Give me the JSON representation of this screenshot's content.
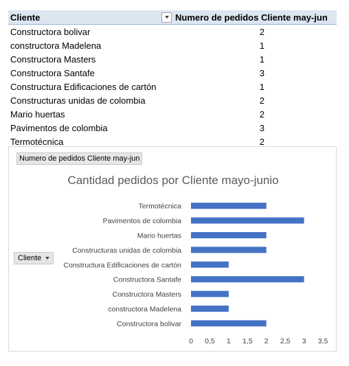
{
  "pivot": {
    "header_col1": "Cliente",
    "header_col2": "Numero de pedidos Cliente may-jun",
    "rows": [
      {
        "name": "Constructora bolivar",
        "value": "2"
      },
      {
        "name": "constructora Madelena",
        "value": "1"
      },
      {
        "name": "Constructora Masters",
        "value": "1"
      },
      {
        "name": "Constructora Santafe",
        "value": "3"
      },
      {
        "name": "Constructura Edificaciones de cartón",
        "value": "1"
      },
      {
        "name": "Constructuras unidas de colombia",
        "value": "2"
      },
      {
        "name": "Mario huertas",
        "value": "2"
      },
      {
        "name": "Pavimentos de colombia",
        "value": "3"
      },
      {
        "name": "Termotécnica",
        "value": "2"
      }
    ]
  },
  "chart_buttons": {
    "value_field": "Numero  de pedidos Cliente may-jun",
    "axis_field": "Cliente"
  },
  "chart_data": {
    "type": "bar",
    "orientation": "horizontal",
    "title": "Cantidad pedidos por Cliente mayo-junio",
    "categories": [
      "Constructora bolivar",
      "constructora Madelena",
      "Constructora Masters",
      "Constructora Santafe",
      "Constructura Edificaciones de cartón",
      "Constructuras unidas de colombia",
      "Mario huertas",
      "Pavimentos de colombia",
      "Termotécnica"
    ],
    "values": [
      2,
      1,
      1,
      3,
      1,
      2,
      2,
      3,
      2
    ],
    "xlim": [
      0,
      3.5
    ],
    "ticks": [
      0,
      0.5,
      1,
      1.5,
      2,
      2.5,
      3,
      3.5
    ],
    "tick_labels": [
      "0",
      "0,5",
      "1",
      "1,5",
      "2",
      "2,5",
      "3",
      "3,5"
    ],
    "bar_color": "#4472c4",
    "grid": false,
    "legend": "none"
  }
}
